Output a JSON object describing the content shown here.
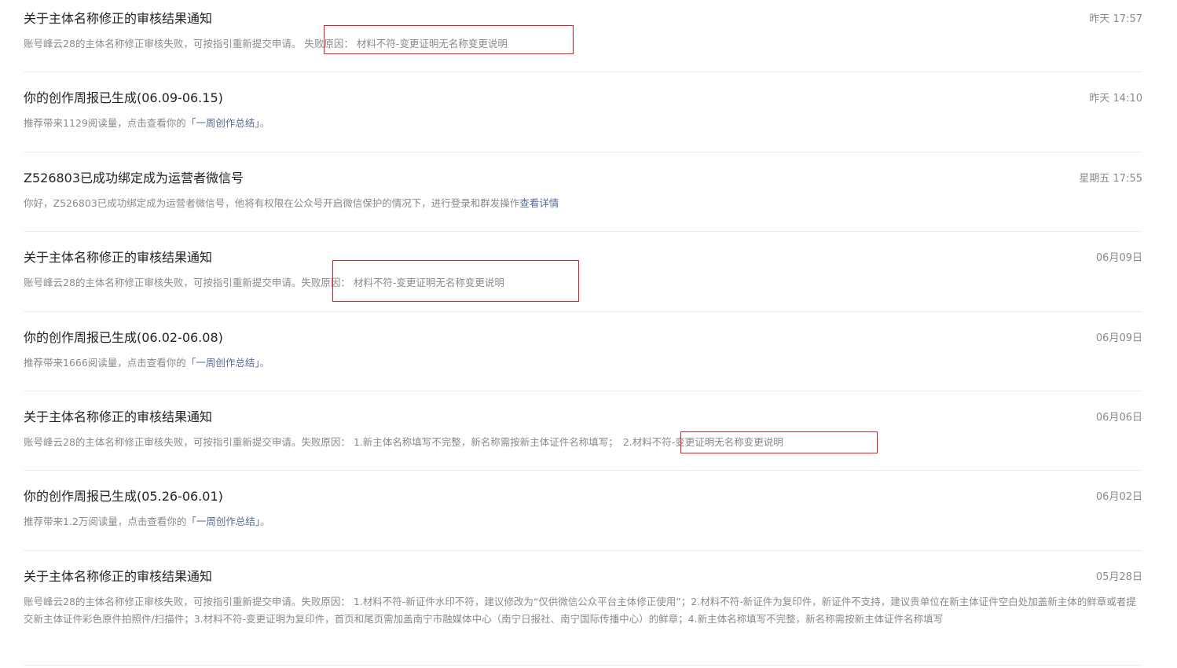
{
  "messages": [
    {
      "title": "关于主体名称修正的审核结果通知",
      "time": "昨天 17:57",
      "desc_pre": "账号峰云28的主体名称修正审核失败，可按指引重新提交申请。",
      "desc_hl": "失败原因： 材料不符-变更证明无名称变更说明"
    },
    {
      "title": "你的创作周报已生成(06.09-06.15)",
      "time": "昨天 14:10",
      "desc_pre": "推荐带来1129阅读量，点击查看你的",
      "desc_link": "「一周创作总结」",
      "desc_post": "。"
    },
    {
      "title": "Z526803已成功绑定成为运营者微信号",
      "time": "星期五 17:55",
      "desc_pre": "你好，Z526803已成功绑定成为运营者微信号，他将有权限在公众号开启微信保护的情况下，进行登录和群发操作",
      "desc_link": "查看详情"
    },
    {
      "title": "关于主体名称修正的审核结果通知",
      "time": "06月09日",
      "desc_pre": "账号峰云28的主体名称修正审核失败，可按指引重新提交申请。",
      "desc_hl": "失败原因： 材料不符-变更证明无名称变更说明"
    },
    {
      "title": "你的创作周报已生成(06.02-06.08)",
      "time": "06月09日",
      "desc_pre": "推荐带来1666阅读量，点击查看你的",
      "desc_link": "「一周创作总结」",
      "desc_post": "。"
    },
    {
      "title": "关于主体名称修正的审核结果通知",
      "time": "06月06日",
      "desc_pre": "账号峰云28的主体名称修正审核失败，可按指引重新提交申请。失败原因： 1.新主体名称填写不完整，新名称需按新主体证件名称填写；",
      "desc_hl": "2.材料不符-变更证明无名称变更说明"
    },
    {
      "title": "你的创作周报已生成(05.26-06.01)",
      "time": "06月02日",
      "desc_pre": "推荐带来1.2万阅读量，点击查看你的",
      "desc_link": "「一周创作总结」",
      "desc_post": "。"
    },
    {
      "title": "关于主体名称修正的审核结果通知",
      "time": "05月28日",
      "desc_pre": "账号峰云28的主体名称修正审核失败，可按指引重新提交申请。失败原因： 1.材料不符-新证件水印不符，建议修改为“仅供微信公众平台主体修正使用”；2.材料不符-新证件为复印件，新证件不支持，建议贵单位在新主体证件空白处加盖新主体的鲜章或者提交新主体证件彩色原件拍照件/扫描件；3.材料不符-变更证明为复印件，首页和尾页需加盖南宁市融媒体中心（南宁日报社、南宁国际传播中心）的鲜章；4.新主体名称填写不完整，新名称需按新主体证件名称填写"
    }
  ],
  "colors": {
    "highlight_box": "#e02020",
    "link": "#576b95",
    "muted": "#8a8a8a"
  }
}
